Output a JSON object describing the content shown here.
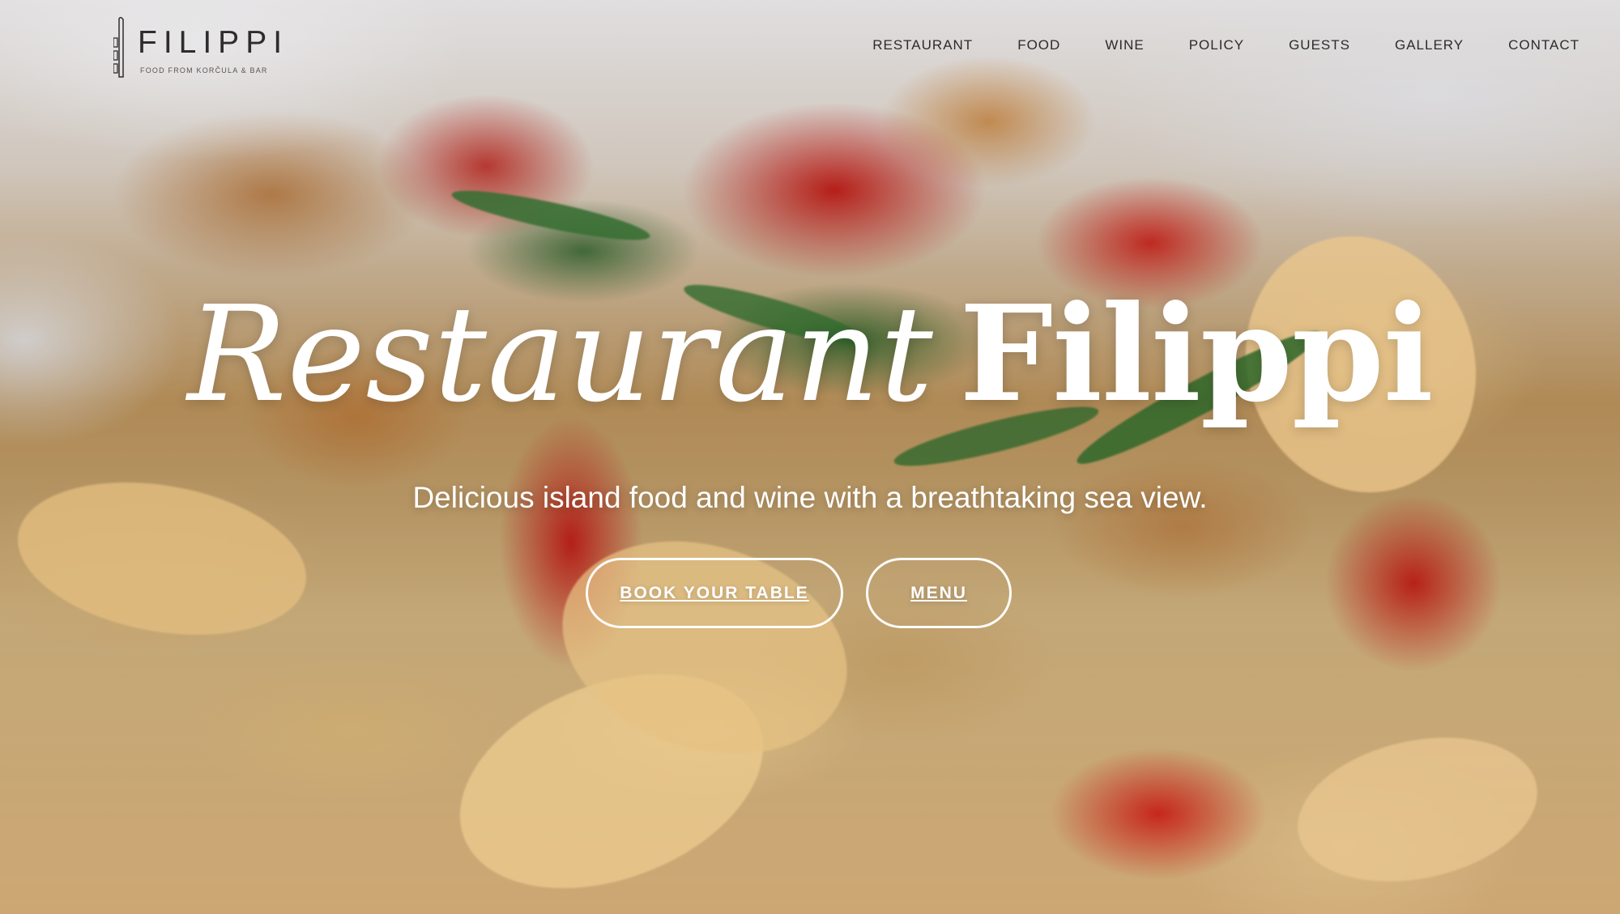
{
  "logo": {
    "title": "FILIPPI",
    "tagline": "FOOD FROM KORČULA & BAR"
  },
  "nav": {
    "items": [
      "RESTAURANT",
      "FOOD",
      "WINE",
      "POLICY",
      "GUESTS",
      "GALLERY",
      "CONTACT"
    ]
  },
  "hero": {
    "title_italic": "Restaurant",
    "title_bold": "Filippi",
    "subtitle": "Delicious island food and wine with a breathtaking sea view.",
    "buttons": {
      "book": "BOOK YOUR TABLE",
      "menu": "MENU"
    }
  },
  "colors": {
    "nav_text": "#2d2b2b",
    "hero_text": "#ffffff",
    "button_border": "#ffffff"
  }
}
